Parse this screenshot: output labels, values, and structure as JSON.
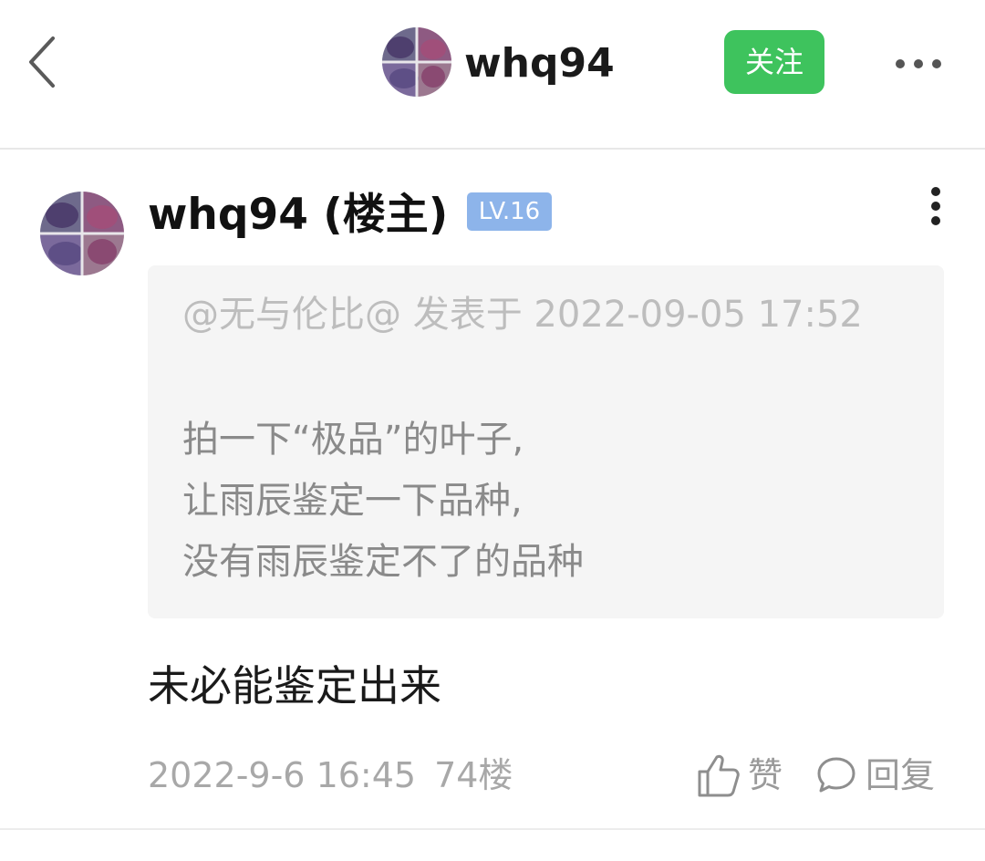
{
  "header": {
    "back_icon": "chevron-left-icon",
    "username": "whq94",
    "follow_label": "关注",
    "more_icon": "more-horizontal-icon",
    "accent_color": "#3ec35d"
  },
  "post": {
    "author": "whq94 (楼主)",
    "level": "LV.16",
    "level_color": "#8db4ea",
    "menu_icon": "more-vertical-icon",
    "quote": {
      "meta": "@无与伦比@ 发表于 2022-09-05 17:52",
      "lines": [
        "拍一下“极品”的叶子,",
        "让雨辰鉴定一下品种,",
        "没有雨辰鉴定不了的品种"
      ]
    },
    "content": "未必能鉴定出来",
    "date": "2022-9-6 16:45",
    "floor": "74楼",
    "like_label": "赞",
    "reply_label": "回复"
  }
}
